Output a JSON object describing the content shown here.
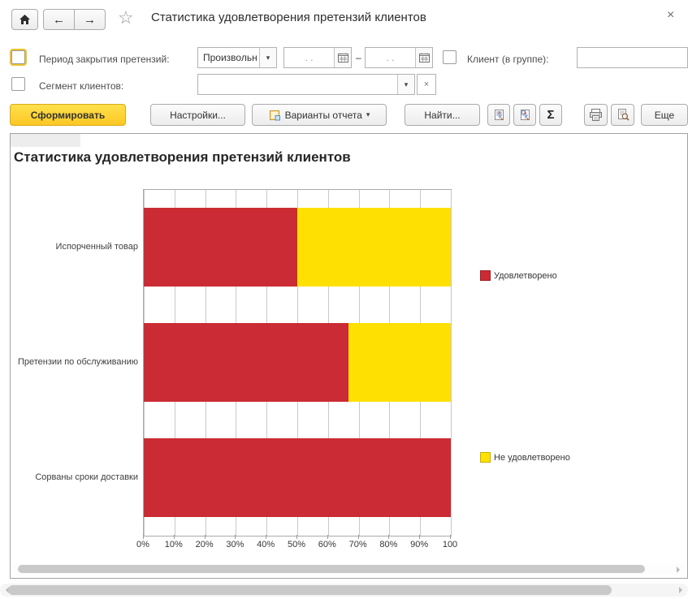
{
  "window": {
    "title": "Статистика удовлетворения претензий клиентов"
  },
  "icons": {
    "star": "☆",
    "close": "×",
    "back": "←",
    "forward": "→",
    "dropdown_arrow": "▾",
    "clear": "×",
    "sigma": "Σ"
  },
  "filters": {
    "period": {
      "checkbox_checked": false,
      "checkbox_focused": true,
      "label": "Период закрытия претензий:",
      "kind": "Произвольн",
      "date_from": ".  .",
      "range_separator": "–",
      "date_to": ".  ."
    },
    "client": {
      "checkbox_checked": false,
      "label": "Клиент (в группе):",
      "value": ""
    },
    "segment": {
      "checkbox_checked": false,
      "label": "Сегмент клиентов:",
      "value": ""
    }
  },
  "actions": {
    "generate": "Сформировать",
    "settings": "Настройки...",
    "variants": "Варианты отчета",
    "find": "Найти...",
    "more": "Еще"
  },
  "chart_data": {
    "type": "bar",
    "stacked": true,
    "orientation": "horizontal",
    "title": "Статистика удовлетворения претензий клиентов",
    "categories": [
      "Испорченный товар",
      "Претензии по обслуживанию",
      "Сорваны сроки доставки"
    ],
    "series": [
      {
        "name": "Удовлетворено",
        "color": "#cb2b34",
        "values": [
          50,
          66.7,
          100
        ]
      },
      {
        "name": "Не удовлетворено",
        "color": "#ffe003",
        "values": [
          50,
          33.3,
          0
        ]
      }
    ],
    "x_ticks": [
      "0%",
      "10%",
      "20%",
      "30%",
      "40%",
      "50%",
      "60%",
      "70%",
      "80%",
      "90%",
      "100"
    ],
    "xlim": [
      0,
      100
    ],
    "grid": true,
    "legend_position": "right"
  }
}
